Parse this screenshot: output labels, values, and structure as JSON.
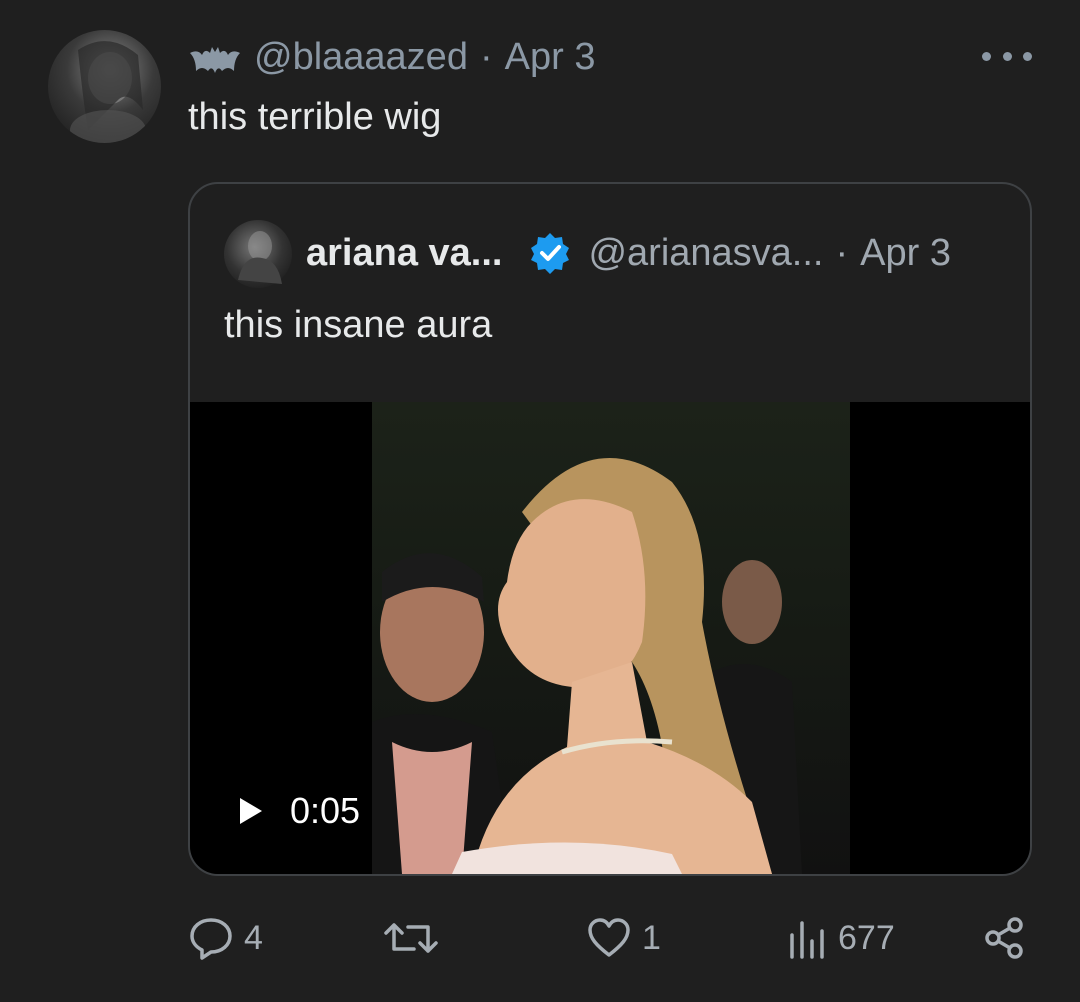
{
  "tweet": {
    "handle": "@blaaaazed",
    "separator": "·",
    "date": "Apr 3",
    "text": "this terrible wig",
    "avatar_icon": "profile-photo",
    "badge_icon": "bat-icon",
    "more_icon": "more-horizontal-icon"
  },
  "quote": {
    "name": "ariana va...",
    "verified_icon": "verified-badge-icon",
    "handle": "@arianasva...",
    "separator": "·",
    "date": "Apr 3",
    "text": "this insane aura",
    "video": {
      "timecode": "0:05",
      "play_icon": "play-icon"
    }
  },
  "actions": {
    "replies": "4",
    "retweets": "",
    "likes": "1",
    "views": "677",
    "icons": [
      "reply-icon",
      "retweet-icon",
      "like-icon",
      "views-icon",
      "share-icon"
    ]
  },
  "colors": {
    "background": "#1f1f1f",
    "text": "#e7e9ea",
    "muted": "#8b98a5",
    "verified": "#1d9bf0",
    "border": "#3e4144"
  }
}
